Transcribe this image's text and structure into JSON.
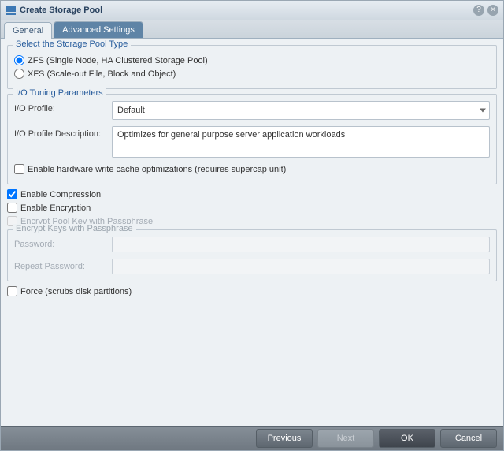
{
  "window": {
    "title": "Create Storage Pool"
  },
  "tabs": {
    "general": "General",
    "advanced": "Advanced Settings"
  },
  "section_storage_type": {
    "title": "Select the Storage Pool Type",
    "opt_zfs": "ZFS (Single Node, HA Clustered Storage Pool)",
    "opt_xfs": "XFS (Scale-out File, Block and Object)"
  },
  "section_io": {
    "title": "I/O Tuning Parameters",
    "profile_label": "I/O Profile:",
    "profile_value": "Default",
    "desc_label": "I/O Profile Description:",
    "desc_value": "Optimizes for general purpose server application workloads",
    "hw_cache": "Enable hardware write cache optimizations (requires supercap unit)"
  },
  "checks": {
    "compression": "Enable Compression",
    "encryption": "Enable Encryption",
    "encrypt_key_pass": "Encrypt Pool Key with Passphrase"
  },
  "section_encrypt": {
    "title": "Encrypt Keys with Passphrase",
    "password": "Password:",
    "repeat": "Repeat Password:"
  },
  "force": "Force (scrubs disk partitions)",
  "buttons": {
    "previous": "Previous",
    "next": "Next",
    "ok": "OK",
    "cancel": "Cancel"
  }
}
